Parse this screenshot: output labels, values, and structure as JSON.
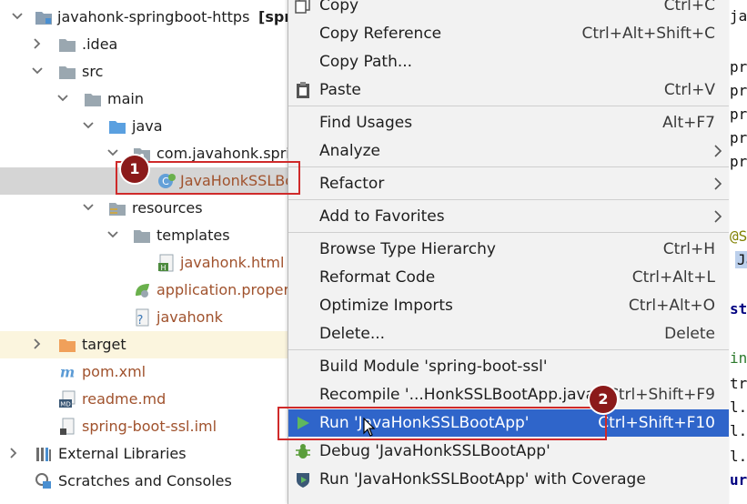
{
  "tree": {
    "root": {
      "label": "javahonk-springboot-https",
      "suffix": "[spr"
    },
    "idea": ".idea",
    "src": "src",
    "main": "main",
    "java": "java",
    "package": "com.javahonk.spri",
    "main_class": "JavaHonkSSLBo",
    "resources": "resources",
    "templates": "templates",
    "html_file": "javahonk.html",
    "app_props": "application.proper",
    "javahonk": "javahonk",
    "target": "target",
    "pom": "pom.xml",
    "readme": "readme.md",
    "iml": "spring-boot-ssl.iml",
    "external_libraries": "External Libraries",
    "scratches": "Scratches and Consoles"
  },
  "menu": {
    "copy": {
      "label": "Copy",
      "shortcut": "Ctrl+C"
    },
    "copy_reference": {
      "label": "Copy Reference",
      "shortcut": "Ctrl+Alt+Shift+C"
    },
    "copy_path": {
      "label": "Copy Path..."
    },
    "paste": {
      "label": "Paste",
      "shortcut": "Ctrl+V"
    },
    "find_usages": {
      "label": "Find Usages",
      "shortcut": "Alt+F7"
    },
    "analyze": {
      "label": "Analyze"
    },
    "refactor": {
      "label": "Refactor"
    },
    "add_favorites": {
      "label": "Add to Favorites"
    },
    "browse_hierarchy": {
      "label": "Browse Type Hierarchy",
      "shortcut": "Ctrl+H"
    },
    "reformat": {
      "label": "Reformat Code",
      "shortcut": "Ctrl+Alt+L"
    },
    "optimize_imports": {
      "label": "Optimize Imports",
      "shortcut": "Ctrl+Alt+O"
    },
    "delete": {
      "label": "Delete...",
      "shortcut": "Delete"
    },
    "build_module": {
      "label": "Build Module 'spring-boot-ssl'"
    },
    "recompile": {
      "label": "Recompile '...HonkSSLBootApp.java'",
      "shortcut": "Ctrl+Shift+F9"
    },
    "run": {
      "label": "Run 'JavaHonkSSLBootApp'",
      "shortcut": "Ctrl+Shift+F10"
    },
    "debug": {
      "label": "Debug 'JavaHonkSSLBootApp'"
    },
    "coverage": {
      "label": "Run 'JavaHonkSSLBootApp' with Coverage"
    }
  },
  "editor_lines": [
    "jav",
    "pri",
    "pri",
    "pri",
    "pri",
    "pri",
    "@Spr",
    "Ja",
    "sta",
    "ing",
    "tri",
    "l.a",
    "l.a",
    "l.a",
    "urn"
  ],
  "annotations": {
    "step1": "1",
    "step2": "2"
  },
  "colors": {
    "highlight": "#2f65ca",
    "annotation": "#cf2a2a",
    "badge": "#8b1a1a",
    "selection": "#d5d5d5"
  }
}
